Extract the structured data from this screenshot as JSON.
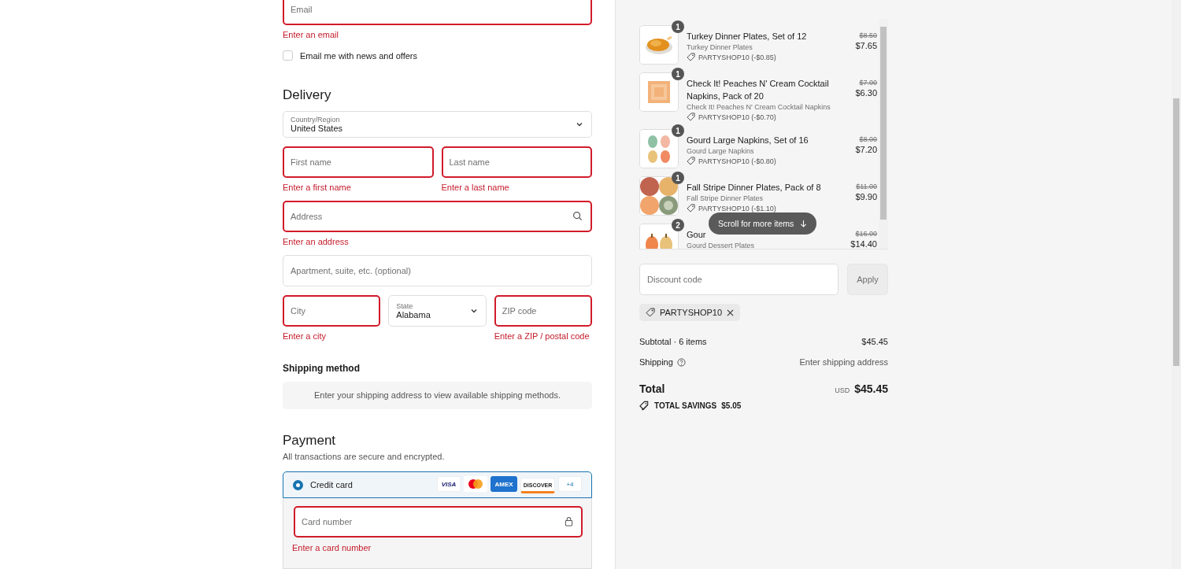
{
  "contact": {
    "email": {
      "placeholder": "Email",
      "error": "Enter an email",
      "invalid": true
    },
    "newsletter": {
      "label": "Email me with news and offers",
      "checked": false
    }
  },
  "delivery": {
    "heading": "Delivery",
    "country": {
      "label": "Country/Region",
      "value": "United States"
    },
    "rows": [
      [
        {
          "kind": "text",
          "placeholder": "First name",
          "error": "Enter a first name",
          "invalid": true
        },
        {
          "kind": "text",
          "placeholder": "Last name",
          "error": "Enter a last name",
          "invalid": true
        }
      ],
      [
        {
          "kind": "search",
          "placeholder": "Address",
          "error": "Enter an address",
          "invalid": true
        }
      ],
      [
        {
          "kind": "text",
          "placeholder": "Apartment, suite, etc. (optional)",
          "invalid": false
        }
      ],
      [
        {
          "kind": "text",
          "placeholder": "City",
          "error": "Enter a city",
          "invalid": true
        },
        {
          "kind": "select",
          "label": "State",
          "value": "Alabama",
          "invalid": false
        },
        {
          "kind": "text",
          "placeholder": "ZIP code",
          "error": "Enter a ZIP / postal code",
          "invalid": true
        }
      ]
    ]
  },
  "shipping_method": {
    "heading": "Shipping method",
    "notice": "Enter your shipping address to view available shipping methods."
  },
  "payment": {
    "heading": "Payment",
    "subtitle": "All transactions are secure and encrypted.",
    "methods": [
      {
        "label": "Credit card",
        "selected": true,
        "brands": [
          {
            "kind": "visa",
            "label": "VISA"
          },
          {
            "kind": "mastercard"
          },
          {
            "kind": "amex",
            "label": "AMEX"
          },
          {
            "kind": "discover",
            "label": "DISCOVER"
          },
          {
            "kind": "more",
            "label": "+4"
          }
        ]
      }
    ],
    "card_number": {
      "placeholder": "Card number",
      "error": "Enter a card number",
      "invalid": true
    }
  },
  "order": {
    "items": [
      {
        "quantity": "1",
        "title": "Turkey Dinner Plates, Set of 12",
        "subtitle": "Turkey Dinner Plates",
        "discount": "PARTYSHOP10 (-$0.85)",
        "original_price": "$8.50",
        "price": "$7.65"
      },
      {
        "quantity": "1",
        "title": "Check It! Peaches N' Cream Cocktail Napkins, Pack of 20",
        "subtitle": "Check It! Peaches N' Cream Cocktail Napkins",
        "discount": "PARTYSHOP10 (-$0.70)",
        "original_price": "$7.00",
        "price": "$6.30"
      },
      {
        "quantity": "1",
        "title": "Gourd Large Napkins, Set of 16",
        "subtitle": "Gourd Large Napkins",
        "discount": "PARTYSHOP10 (-$0.80)",
        "original_price": "$8.00",
        "price": "$7.20"
      },
      {
        "quantity": "1",
        "title": "Fall Stripe Dinner Plates, Pack of 8",
        "subtitle": "Fall Stripe Dinner Plates",
        "discount": "PARTYSHOP10 (-$1.10)",
        "original_price": "$11.00",
        "price": "$9.90"
      },
      {
        "quantity": "2",
        "title": "Gour",
        "subtitle": "Gourd Dessert Plates",
        "original_price": "$16.00",
        "price": "$14.40"
      }
    ],
    "scroll_hint": "Scroll for more items",
    "discount_field": {
      "placeholder": "Discount code"
    },
    "apply_button": {
      "label": "Apply",
      "disabled": true
    },
    "applied_codes": [
      "PARTYSHOP10"
    ],
    "subtotal": {
      "label": "Subtotal · 6 items",
      "value": "$45.45"
    },
    "shipping": {
      "label": "Shipping",
      "value": "Enter shipping address"
    },
    "total": {
      "label": "Total",
      "currency": "USD",
      "value": "$45.45"
    },
    "savings": {
      "label": "TOTAL SAVINGS",
      "value": "$5.05"
    }
  }
}
